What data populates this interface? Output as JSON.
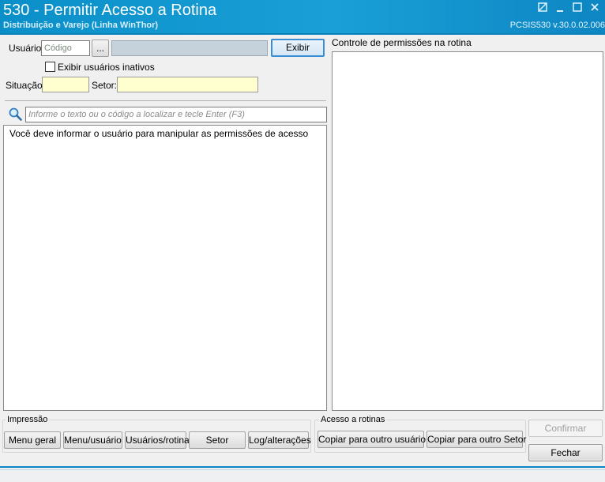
{
  "window": {
    "title": "530 - Permitir Acesso a Rotina",
    "subtitle": "Distribuição e Varejo (Linha WinThor)",
    "version": "PCSIS530  v.30.0.02.006"
  },
  "form": {
    "usuario_label": "Usuário:",
    "usuario_code_placeholder": "Código",
    "browse_label": "...",
    "exibir_label": "Exibir",
    "inativos_label": "Exibir usuários inativos",
    "situacao_label": "Situação:",
    "setor_label": "Setor:"
  },
  "search": {
    "placeholder": "Informe o texto ou o código a localizar e tecle Enter (F3)"
  },
  "list": {
    "message": "Você deve informar o usuário para manipular as permissões de acesso"
  },
  "permissions": {
    "title": "Controle de permissões na rotina"
  },
  "impressao": {
    "title": "Impressão",
    "buttons": [
      "Menu geral",
      "Menu/usuário",
      "Usuários/rotina",
      "Setor",
      "Log/alterações"
    ]
  },
  "acesso": {
    "title": "Acesso a rotinas",
    "buttons": [
      "Copiar para outro usuário",
      "Copiar para outro Setor"
    ]
  },
  "actions": {
    "confirmar": "Confirmar",
    "fechar": "Fechar"
  }
}
